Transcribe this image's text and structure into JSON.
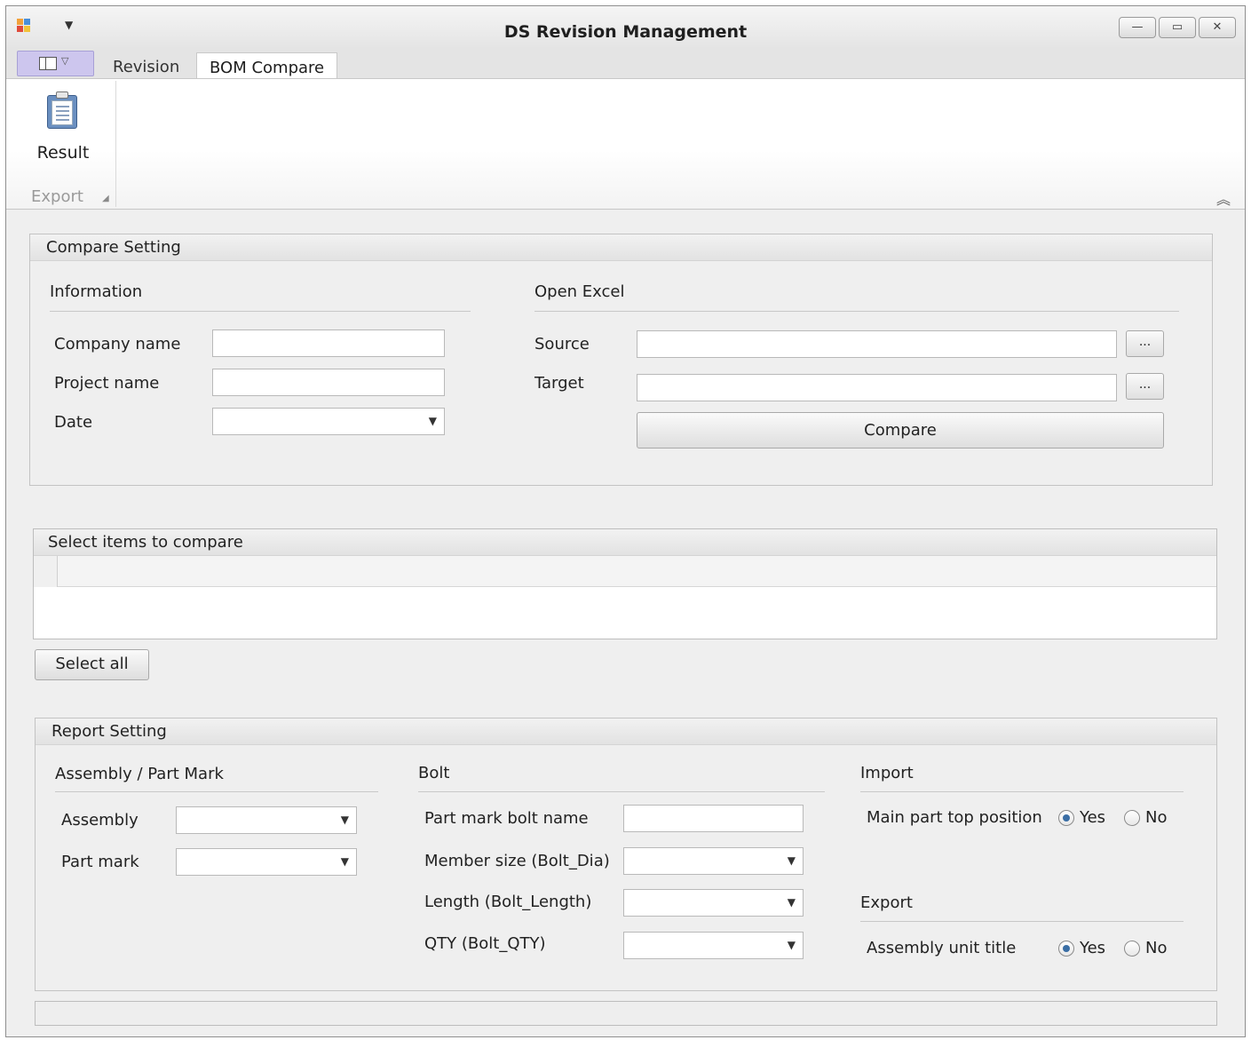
{
  "window": {
    "title": "DS Revision Management",
    "controls": {
      "minimize": "—",
      "maximize": "▭",
      "close": "✕"
    }
  },
  "ribbon": {
    "tabs": [
      "Revision",
      "BOM Compare"
    ],
    "active_tab": "BOM Compare",
    "result_label": "Result",
    "group_label": "Export"
  },
  "compare_setting": {
    "title": "Compare Setting",
    "information": {
      "title": "Information",
      "company_label": "Company name",
      "company_value": "",
      "project_label": "Project name",
      "project_value": "",
      "date_label": "Date",
      "date_value": ""
    },
    "open_excel": {
      "title": "Open Excel",
      "source_label": "Source",
      "source_value": "",
      "target_label": "Target",
      "target_value": "",
      "browse_label": "...",
      "compare_label": "Compare"
    }
  },
  "select_items": {
    "title": "Select items to compare",
    "select_all_label": "Select all"
  },
  "report_setting": {
    "title": "Report Setting",
    "assembly_part": {
      "title": "Assembly / Part Mark",
      "assembly_label": "Assembly",
      "assembly_value": "",
      "part_mark_label": "Part mark",
      "part_mark_value": ""
    },
    "bolt": {
      "title": "Bolt",
      "part_mark_bolt_label": "Part mark bolt name",
      "part_mark_bolt_value": "",
      "member_size_label": "Member size (Bolt_Dia)",
      "member_size_value": "",
      "length_label": "Length (Bolt_Length)",
      "length_value": "",
      "qty_label": "QTY (Bolt_QTY)",
      "qty_value": ""
    },
    "import": {
      "title": "Import",
      "main_part_label": "Main part top position",
      "yes_label": "Yes",
      "no_label": "No",
      "selected": "Yes"
    },
    "export": {
      "title": "Export",
      "assembly_unit_label": "Assembly unit title",
      "yes_label": "Yes",
      "no_label": "No",
      "selected": "Yes"
    }
  },
  "colors": {
    "accent_purple": "#cdc6ee",
    "radio_selected": "#3a6ea5",
    "background": "#efefef"
  }
}
